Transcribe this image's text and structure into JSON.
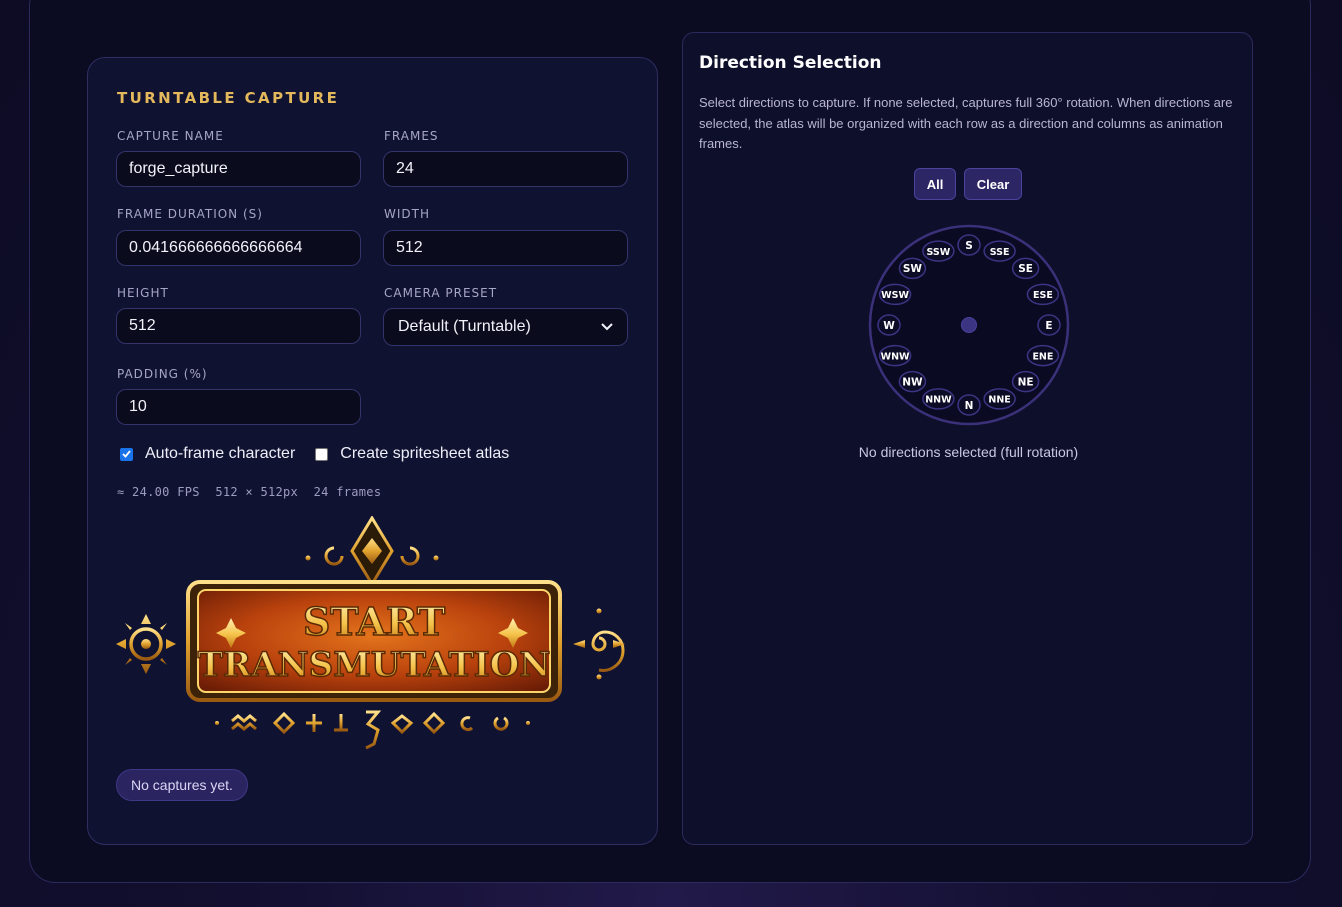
{
  "capture": {
    "title": "TURNTABLE CAPTURE",
    "fields": {
      "capture_name": {
        "label": "CAPTURE NAME",
        "value": "forge_capture"
      },
      "frames": {
        "label": "FRAMES",
        "value": "24"
      },
      "frame_duration": {
        "label": "FRAME DURATION (S)",
        "value": "0.041666666666666664"
      },
      "width": {
        "label": "WIDTH",
        "value": "512"
      },
      "height": {
        "label": "HEIGHT",
        "value": "512"
      },
      "camera_preset": {
        "label": "CAMERA PRESET",
        "value": "Default (Turntable)"
      },
      "padding": {
        "label": "PADDING (%)",
        "value": "10"
      }
    },
    "checkboxes": {
      "auto_frame": {
        "label": "Auto-frame character",
        "checked": true
      },
      "atlas": {
        "label": "Create spritesheet atlas",
        "checked": false
      }
    },
    "stats": {
      "fps": "≈ 24.00 FPS",
      "size": "512 × 512px",
      "frames": "24 frames"
    },
    "start_button": {
      "line1": "START",
      "line2": "TRANSMUTATION"
    },
    "captures_status": "No captures yet."
  },
  "direction": {
    "title": "Direction Selection",
    "description": "Select directions to capture. If none selected, captures full 360° rotation. When directions are selected, the atlas will be organized with each row as a direction and columns as animation frames.",
    "all_label": "All",
    "clear_label": "Clear",
    "directions": [
      "S",
      "SSE",
      "SE",
      "ESE",
      "E",
      "ENE",
      "NE",
      "NNE",
      "N",
      "NNW",
      "NW",
      "WNW",
      "W",
      "WSW",
      "SW",
      "SSW"
    ],
    "status": "No directions selected (full rotation)"
  },
  "colors": {
    "accent_gold": "#e4b95c",
    "accent_purple": "#2c2664",
    "panel_border": "#2f2d62"
  }
}
